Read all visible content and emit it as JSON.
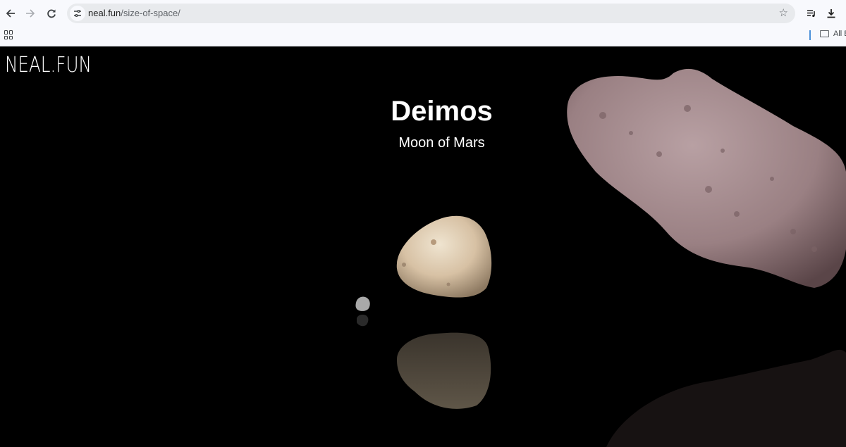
{
  "browser": {
    "url_domain": "neal.fun",
    "url_path": "/size-of-space/",
    "bookmarks_label": "All B",
    "icons": {
      "back": "arrow-left-icon",
      "forward": "arrow-right-icon",
      "reload": "reload-icon",
      "site_info": "tune-icon",
      "bookmark_star": "star-icon",
      "media": "playlist-icon",
      "download": "download-icon",
      "apps": "apps-grid-icon",
      "folder": "folder-icon"
    }
  },
  "page": {
    "logo": "NEAL.FUN",
    "object_name": "Deimos",
    "object_subtitle": "Moon of Mars",
    "bodies": [
      {
        "name": "small-asteroid",
        "color": "#9a9a9a"
      },
      {
        "name": "deimos",
        "color": "#d9c3a6"
      },
      {
        "name": "ida-asteroid",
        "color": "#a0858a"
      }
    ]
  }
}
